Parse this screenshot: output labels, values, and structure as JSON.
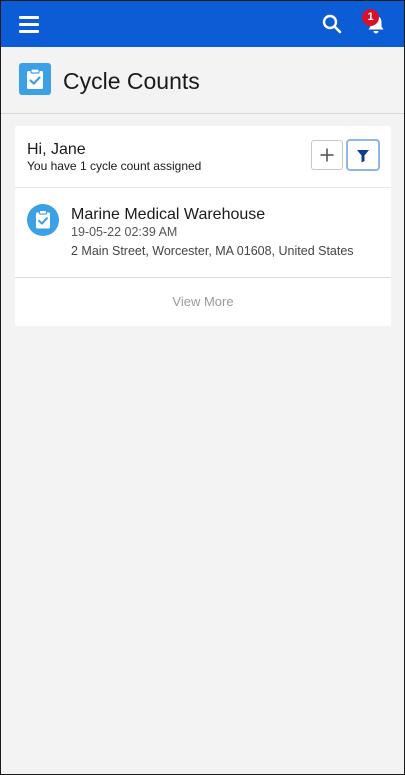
{
  "topbar": {
    "menu_icon": "hamburger-icon",
    "search_icon": "search-icon",
    "bell_icon": "bell-icon",
    "notification_count": "1"
  },
  "page": {
    "title": "Cycle Counts",
    "icon": "clipboard-check-icon"
  },
  "card": {
    "greeting": "Hi, Jane",
    "subtitle": "You have 1 cycle count assigned",
    "add_icon": "plus-icon",
    "filter_icon": "filter-icon",
    "record": {
      "name": "Marine Medical Warehouse",
      "date": "19-05-22 02:39 AM",
      "address": "2 Main Street, Worcester, MA 01608, United States",
      "icon": "clipboard-check-icon"
    },
    "view_more": "View More"
  },
  "colors": {
    "brand": "#0b5cd5",
    "accent": "#3ba0e6",
    "badge": "#d8102b",
    "filter_blue": "#0b3d91"
  }
}
